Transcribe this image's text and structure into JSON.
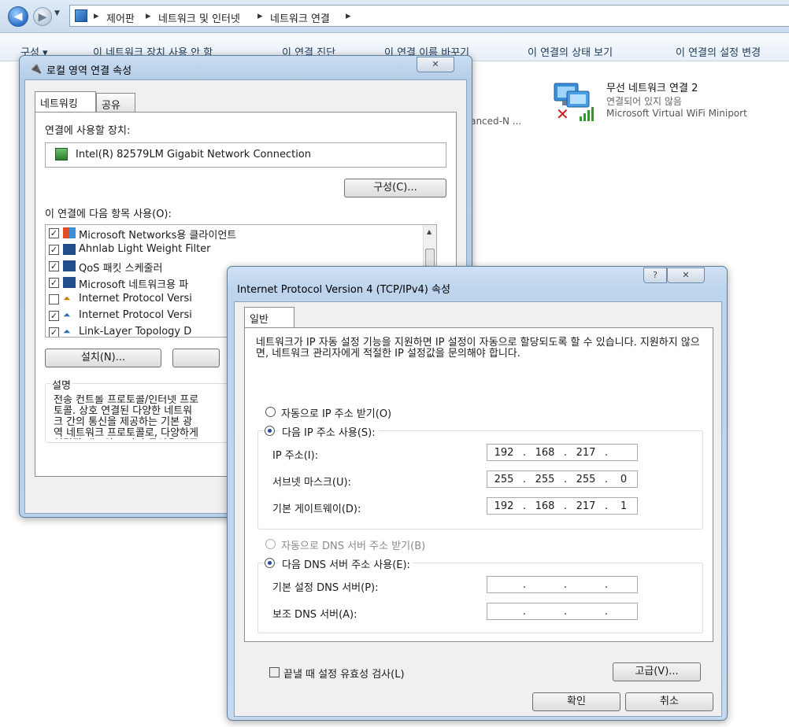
{
  "explorer": {
    "breadcrumb": [
      "제어판",
      "네트워크 및 인터넷",
      "네트워크 연결"
    ],
    "toolbar": [
      "구성 ▾",
      "이 네트워크 장치 사용 안 함",
      "이 연결 진단",
      "이 연결 이름 바꾸기",
      "이 연결의 상태 보기",
      "이 연결의 설정 변경"
    ],
    "adapter_fragment": "vanced-N ...",
    "wifi": {
      "name": "무선 네트워크 연결 2",
      "status": "연결되어 있지 않음",
      "device": "Microsoft Virtual WiFi Miniport"
    }
  },
  "local_dialog": {
    "title": "로컬 영역 연결 속성",
    "tabs": [
      "네트워킹",
      "공유"
    ],
    "connect_using_label": "연결에 사용할 장치:",
    "device": "Intel(R) 82579LM Gigabit Network Connection",
    "configure_button": "구성(C)...",
    "items_label": "이 연결에 다음 항목 사용(O):",
    "items": [
      {
        "label": "Microsoft Networks용 클라이언트",
        "checked": true
      },
      {
        "label": "Ahnlab Light Weight Filter",
        "checked": true
      },
      {
        "label": "QoS 패킷 스케줄러",
        "checked": true
      },
      {
        "label": "Microsoft 네트워크용 파",
        "checked": true
      },
      {
        "label": "Internet Protocol Versi",
        "checked": false
      },
      {
        "label": "Internet Protocol Versi",
        "checked": true
      },
      {
        "label": "Link-Layer Topology D",
        "checked": true
      }
    ],
    "install_button": "설치(N)...",
    "description_label": "설명",
    "description": "전송 컨트롤 프로토콜/인터넷 프로토콜. 상호 연결된 다양한 네트워크 간의 통신을 제공하는 기본 광역 네트워크 프로토콜로, 다양하게 연결된 네트워크 간의 통신을 제공합니다."
  },
  "ipv4_dialog": {
    "title": "Internet Protocol Version 4 (TCP/IPv4) 속성",
    "help": "?",
    "close": "✕",
    "tab": "일반",
    "intro": "네트워크가 IP 자동 설정 기능을 지원하면 IP 설정이 자동으로 할당되도록 할 수 있습니다. 지원하지 않으면, 네트워크 관리자에게 적절한 IP 설정값을 문의해야 합니다.",
    "auto_ip": "자동으로 IP 주소 받기(O)",
    "manual_ip": "다음 IP 주소 사용(S):",
    "ip_label": "IP 주소(I):",
    "ip": [
      "192",
      "168",
      "217",
      ""
    ],
    "subnet_label": "서브넷 마스크(U):",
    "subnet": [
      "255",
      "255",
      "255",
      "0"
    ],
    "gateway_label": "기본 게이트웨이(D):",
    "gateway": [
      "192",
      "168",
      "217",
      "1"
    ],
    "auto_dns": "자동으로 DNS 서버 주소 받기(B)",
    "manual_dns": "다음 DNS 서버 주소 사용(E):",
    "dns1_label": "기본 설정 DNS 서버(P):",
    "dns2_label": "보조 DNS 서버(A):",
    "validate": "끝낼 때 설정 유효성 검사(L)",
    "advanced_button": "고급(V)...",
    "ok_button": "확인",
    "cancel_button": "취소"
  }
}
